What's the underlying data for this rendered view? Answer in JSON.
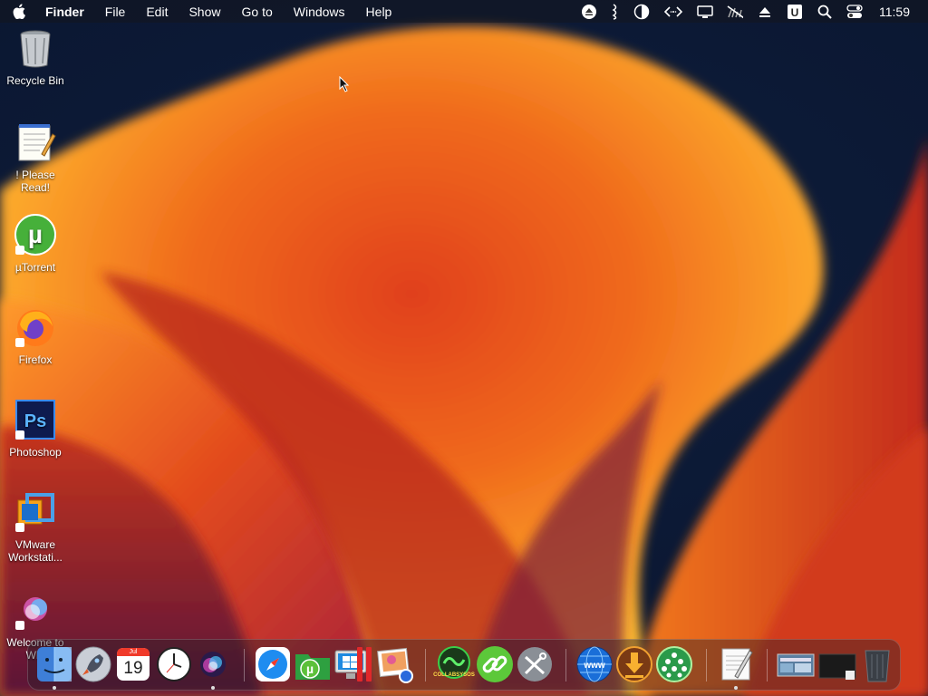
{
  "menubar": {
    "app_name": "Finder",
    "menus": [
      "File",
      "Edit",
      "Show",
      "Go to",
      "Windows",
      "Help"
    ],
    "status_icons": [
      "eject-icon",
      "wifi-icon",
      "contrast-icon",
      "code-icon",
      "display-icon",
      "mute-icon",
      "upload-icon",
      "u-icon",
      "search-icon",
      "control-center-icon"
    ],
    "clock": "11:59"
  },
  "desktop": {
    "icons": [
      {
        "label": "Recycle Bin",
        "icon": "recycle-bin-icon"
      },
      {
        "label": "! Please Read!",
        "icon": "notepad-icon"
      },
      {
        "label": "µTorrent",
        "icon": "utorrent-icon"
      },
      {
        "label": "Firefox",
        "icon": "firefox-icon"
      },
      {
        "label": "Photoshop",
        "icon": "photoshop-icon"
      },
      {
        "label": "VMware\nWorkstati...",
        "icon": "vmware-icon"
      },
      {
        "label": "Welcome to\nWin",
        "icon": "welcome-icon"
      }
    ]
  },
  "dock": {
    "calendar_month": "Jul",
    "calendar_day": "19",
    "collab_label": "COLLABSYSOS",
    "items": [
      "finder-icon",
      "launchpad-icon",
      "calendar-icon",
      "clock-icon",
      "siri-icon",
      "safari-icon",
      "utorrent-folder-icon",
      "windows-app-icon",
      "parallels-icon",
      "preview-icon",
      "collabsysos-icon",
      "link-icon",
      "utilities-icon",
      "www-icon",
      "download-icon",
      "network-icon",
      "textedit-icon",
      "screenshot-icon",
      "monitor-icon",
      "trash-icon"
    ]
  },
  "colors": {
    "menubar_bg": "#14161e",
    "wallpaper_orange": "#f58a1e",
    "wallpaper_red": "#c8301e",
    "wallpaper_purple": "#6a1a40"
  }
}
